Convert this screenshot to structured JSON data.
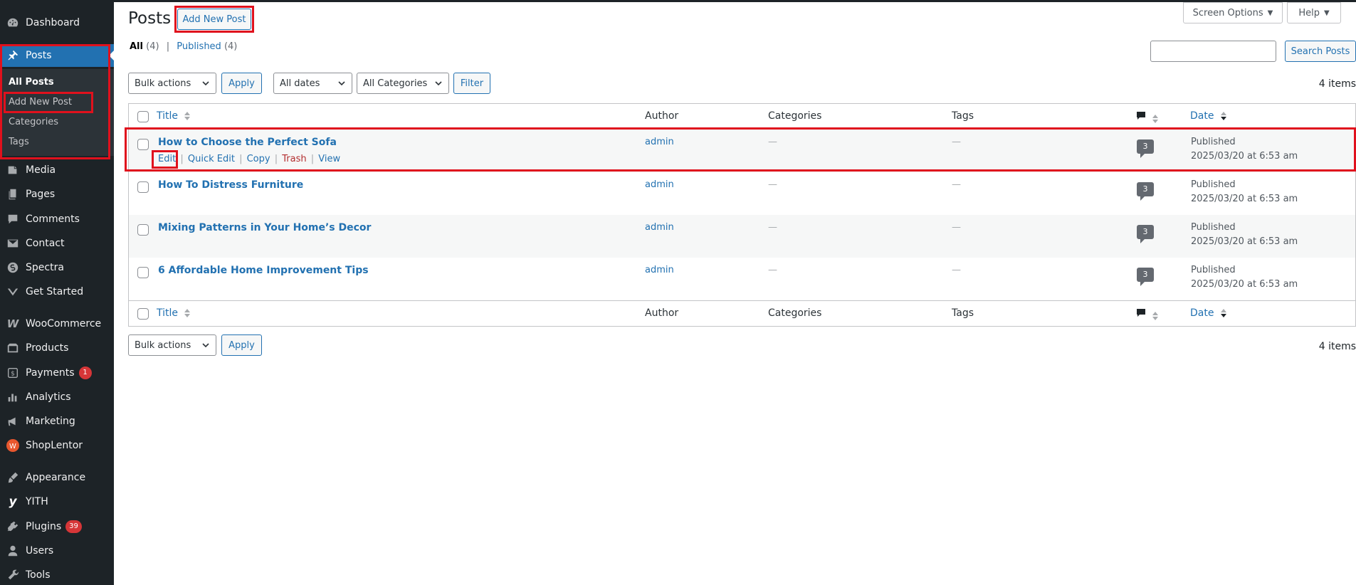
{
  "sidebar": {
    "items": [
      {
        "label": "Dashboard",
        "icon": "dashboard-icon"
      },
      {
        "label": "Posts",
        "icon": "pin-icon"
      },
      {
        "label": "Media",
        "icon": "media-icon"
      },
      {
        "label": "Pages",
        "icon": "pages-icon"
      },
      {
        "label": "Comments",
        "icon": "comments-icon"
      },
      {
        "label": "Contact",
        "icon": "mail-icon"
      },
      {
        "label": "Spectra",
        "icon": "spectra-icon"
      },
      {
        "label": "Get Started",
        "icon": "get-started-icon"
      },
      {
        "label": "WooCommerce",
        "icon": "woocommerce-icon"
      },
      {
        "label": "Products",
        "icon": "products-icon"
      },
      {
        "label": "Payments",
        "icon": "payments-icon",
        "badge": "1"
      },
      {
        "label": "Analytics",
        "icon": "analytics-icon"
      },
      {
        "label": "Marketing",
        "icon": "megaphone-icon"
      },
      {
        "label": "ShopLentor",
        "icon": "shoplentor-icon"
      },
      {
        "label": "Appearance",
        "icon": "paintbrush-icon"
      },
      {
        "label": "YITH",
        "icon": "yith-icon"
      },
      {
        "label": "Plugins",
        "icon": "plugins-icon",
        "badge": "39"
      },
      {
        "label": "Users",
        "icon": "users-icon"
      },
      {
        "label": "Tools",
        "icon": "tools-icon"
      }
    ],
    "submenu": [
      "All Posts",
      "Add New Post",
      "Categories",
      "Tags"
    ]
  },
  "header": {
    "title": "Posts",
    "add_new": "Add New Post",
    "screen_options": "Screen Options",
    "help": "Help"
  },
  "filters": {
    "all_label": "All",
    "all_count": "(4)",
    "separator": "|",
    "published_label": "Published",
    "published_count": "(4)",
    "search_button": "Search Posts",
    "bulk_actions": "Bulk actions",
    "apply": "Apply",
    "all_dates": "All dates",
    "all_categories": "All Categories",
    "filter": "Filter",
    "items_count": "4 items"
  },
  "table": {
    "columns": {
      "title": "Title",
      "author": "Author",
      "categories": "Categories",
      "tags": "Tags",
      "date": "Date"
    },
    "row_actions": {
      "edit": "Edit",
      "quick_edit": "Quick Edit",
      "copy": "Copy",
      "trash": "Trash",
      "view": "View",
      "sep": "|"
    },
    "rows": [
      {
        "title": "How to Choose the Perfect Sofa",
        "author": "admin",
        "categories": "—",
        "tags": "—",
        "comments": "3",
        "status": "Published",
        "date": "2025/03/20 at 6:53 am"
      },
      {
        "title": "How To Distress Furniture",
        "author": "admin",
        "categories": "—",
        "tags": "—",
        "comments": "3",
        "status": "Published",
        "date": "2025/03/20 at 6:53 am"
      },
      {
        "title": "Mixing Patterns in Your Home’s Decor",
        "author": "admin",
        "categories": "—",
        "tags": "—",
        "comments": "3",
        "status": "Published",
        "date": "2025/03/20 at 6:53 am"
      },
      {
        "title": "6 Affordable Home Improvement Tips",
        "author": "admin",
        "categories": "—",
        "tags": "—",
        "comments": "3",
        "status": "Published",
        "date": "2025/03/20 at 6:53 am"
      }
    ]
  },
  "colors": {
    "sidebar_bg": "#1d2327",
    "accent": "#2271b1",
    "highlight": "#e0111d",
    "badge": "#d63638"
  }
}
